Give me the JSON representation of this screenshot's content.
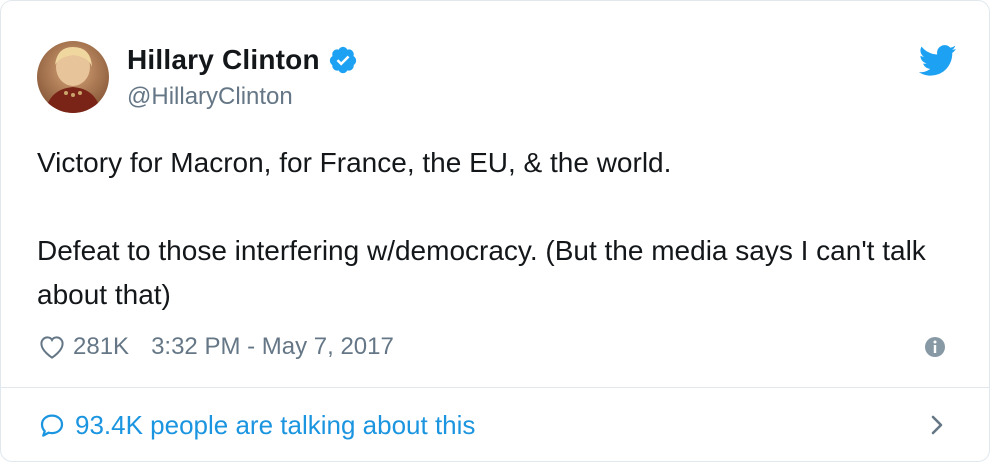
{
  "user": {
    "display_name": "Hillary Clinton",
    "handle": "@HillaryClinton",
    "verified_icon": "verified-badge-icon",
    "avatar_icon": "avatar"
  },
  "brand": {
    "icon": "twitter-bird-icon",
    "color": "#1da1f2"
  },
  "tweet": {
    "line1": "Victory for Macron, for France, the EU, & the world.",
    "line2": "Defeat to those interfering w/democracy. (But the media says I can't talk about that)"
  },
  "meta": {
    "like_count": "281K",
    "timestamp": "3:32 PM - May 7, 2017",
    "like_icon": "heart-icon",
    "info_icon": "info-icon"
  },
  "footer": {
    "talking_label": "93.4K people are talking about this",
    "comment_icon": "comment-icon",
    "chevron_icon": "chevron-right-icon",
    "link_color": "#1b95e0"
  },
  "colors": {
    "text": "#14171a",
    "secondary": "#657786",
    "border": "#e1e8ed"
  }
}
